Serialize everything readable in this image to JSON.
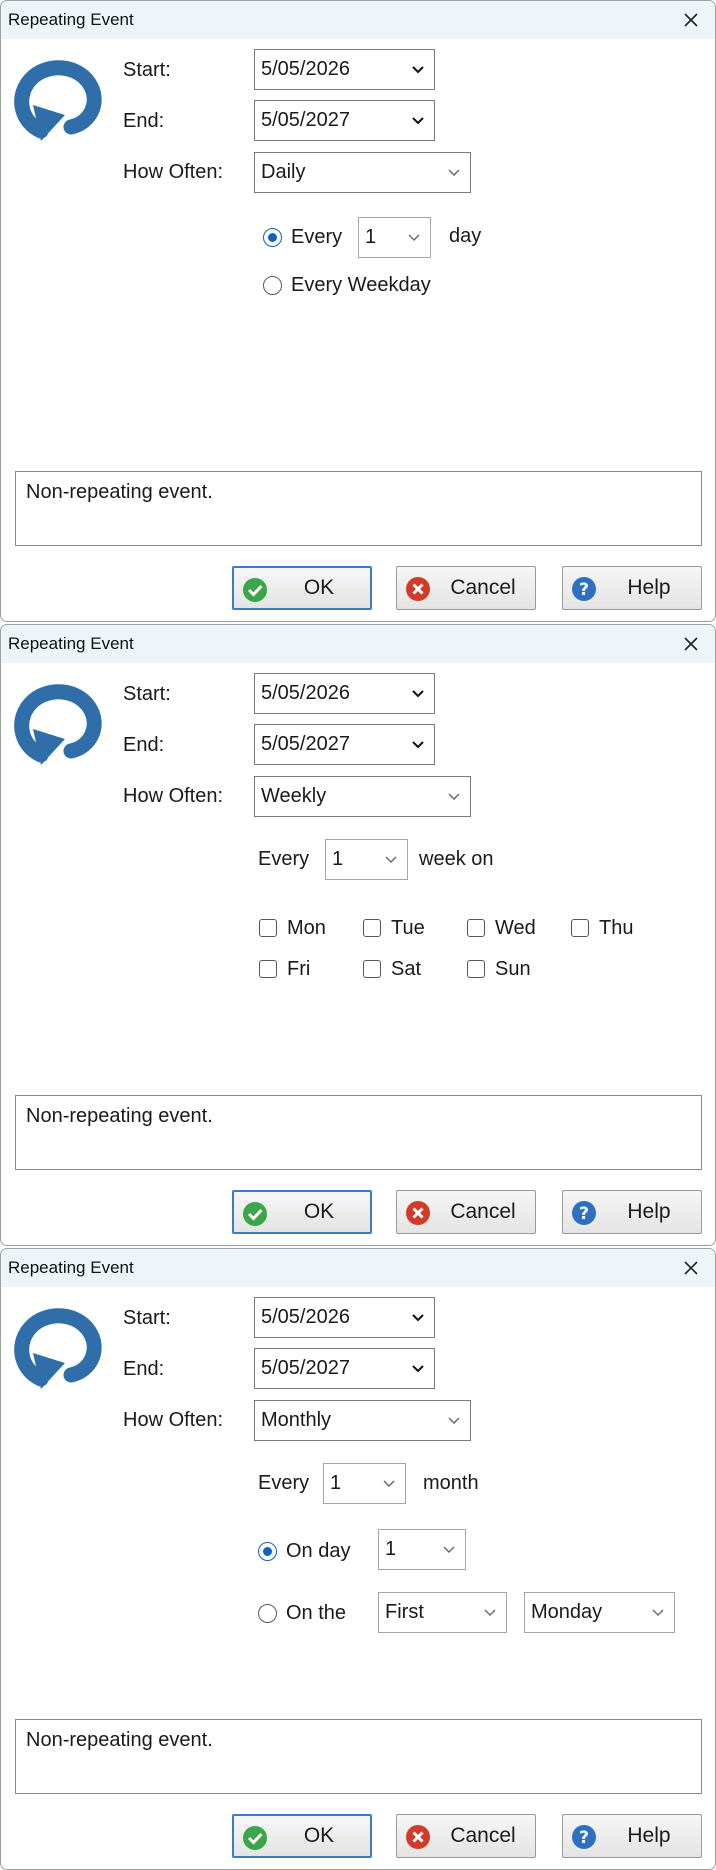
{
  "window_title": "Repeating Event",
  "colors": {
    "accent": "#0f62c2",
    "icon_blue": "#2f6ea8",
    "ok_green": "#3aa54a",
    "cancel_red": "#d23a2a",
    "help_blue": "#2e6fbf"
  },
  "labels": {
    "start": "Start:",
    "end": "End:",
    "how_often": "How Often:"
  },
  "buttons": {
    "ok": "OK",
    "cancel": "Cancel",
    "help": "Help"
  },
  "summary": "Non-repeating event.",
  "dialogs": [
    {
      "start": "5/05/2026",
      "end": "5/05/2027",
      "how_often": "Daily",
      "every_label": "Every",
      "every_value": "1",
      "every_unit": "day",
      "weekday_label": "Every Weekday"
    },
    {
      "start": "5/05/2026",
      "end": "5/05/2027",
      "how_often": "Weekly",
      "every_label": "Every",
      "every_value": "1",
      "every_unit": "week on",
      "days": [
        "Mon",
        "Tue",
        "Wed",
        "Thu",
        "Fri",
        "Sat",
        "Sun"
      ]
    },
    {
      "start": "5/05/2026",
      "end": "5/05/2027",
      "how_often": "Monthly",
      "every_label": "Every",
      "every_value": "1",
      "every_unit": "month",
      "on_day_label": "On day",
      "on_day_value": "1",
      "on_the_label": "On the",
      "on_the_ordinal": "First",
      "on_the_weekday": "Monday"
    }
  ]
}
